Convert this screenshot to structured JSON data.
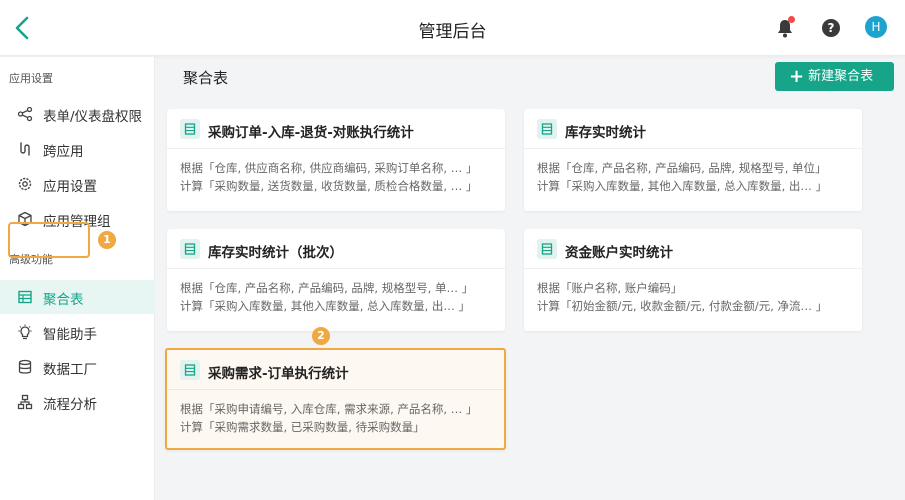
{
  "topbar": {
    "title": "管理后台",
    "avatar": "H",
    "help": "?"
  },
  "sidebar": {
    "section1": "应用设置",
    "section2": "高级功能",
    "items": [
      {
        "label": "表单/仪表盘权限",
        "icon": "share-icon"
      },
      {
        "label": "跨应用",
        "icon": "link-icon"
      },
      {
        "label": "应用设置",
        "icon": "gear-icon"
      },
      {
        "label": "应用管理组",
        "icon": "cube-icon"
      },
      {
        "label": "聚合表",
        "icon": "table-icon",
        "active": true
      },
      {
        "label": "智能助手",
        "icon": "bulb-icon"
      },
      {
        "label": "数据工厂",
        "icon": "database-icon"
      },
      {
        "label": "流程分析",
        "icon": "flow-icon"
      }
    ]
  },
  "badges": [
    "1",
    "2"
  ],
  "main": {
    "header": "聚合表",
    "new_button": "新建聚合表",
    "cards": [
      {
        "title": "采购订单-入库-退货-对账执行统计",
        "line1": "根据「仓库, 供应商名称, 供应商编码, 采购订单名称, … 」",
        "line2": "计算「采购数量, 送货数量, 收货数量, 质检合格数量, … 」"
      },
      {
        "title": "库存实时统计",
        "line1": "根据「仓库, 产品名称, 产品编码, 品牌, 规格型号, 单位」",
        "line2": "计算「采购入库数量, 其他入库数量, 总入库数量, 出… 」"
      },
      {
        "title": "库存实时统计（批次）",
        "line1": "根据「仓库, 产品名称, 产品编码, 品牌, 规格型号, 单… 」",
        "line2": "计算「采购入库数量, 其他入库数量, 总入库数量, 出… 」"
      },
      {
        "title": "资金账户实时统计",
        "line1": "根据「账户名称, 账户编码」",
        "line2": "计算「初始金额/元, 收款金额/元, 付款金额/元, 净流… 」"
      },
      {
        "title": "采购需求-订单执行统计",
        "line1": "根据「采购申请编号, 入库仓库, 需求来源, 产品名称, … 」",
        "line2": "计算「采购需求数量, 已采购数量, 待采购数量」"
      }
    ]
  },
  "colors": {
    "accent": "#16a589",
    "highlight": "#f0a840",
    "avatar": "#1ea3cf",
    "notify": "#f04b4b"
  }
}
